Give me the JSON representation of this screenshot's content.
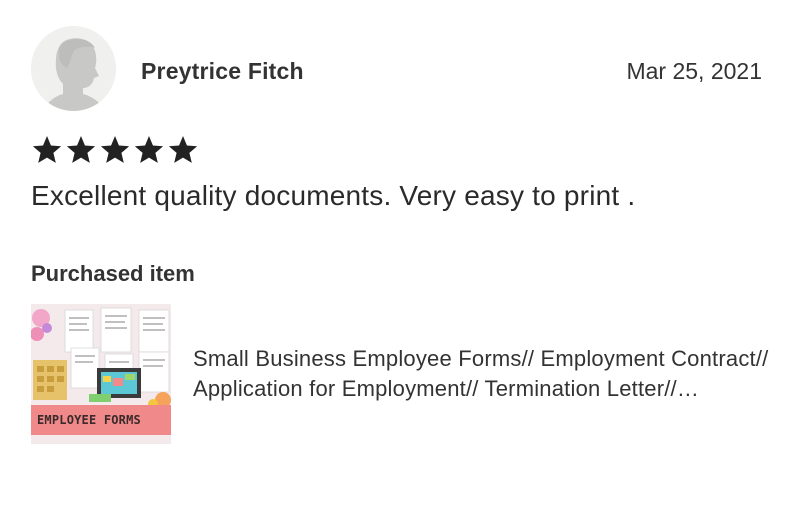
{
  "review": {
    "reviewer_name": "Preytrice Fitch",
    "date": "Mar 25, 2021",
    "rating": 5,
    "rating_max": 5,
    "text": "Excellent quality documents. Very easy to print ."
  },
  "purchased": {
    "heading": "Purchased item",
    "thumbnail_caption": "EMPLOYEE FORMS",
    "item_title": "Small Business Employee Forms// Employment Contract// Application for Employment// Termination Letter// Employee Handbook"
  },
  "colors": {
    "star": "#222222",
    "avatar_background": "#f0f0ee",
    "avatar_silhouette": "#c8c8c6",
    "thumbnail_banner": "#f08a8a"
  },
  "icons": {
    "avatar": "default-user-silhouette",
    "rating": "star-filled"
  }
}
